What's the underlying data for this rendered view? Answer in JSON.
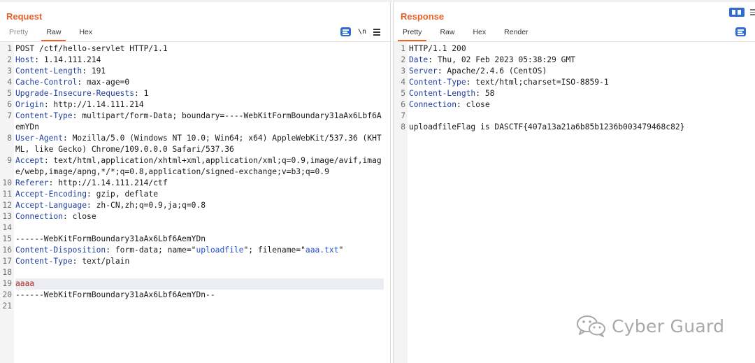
{
  "request": {
    "title": "Request",
    "tabs": [
      {
        "label": "Pretty"
      },
      {
        "label": "Raw"
      },
      {
        "label": "Hex"
      }
    ],
    "newline_toggle": "\\n",
    "lines": [
      {
        "n": "1",
        "segments": [
          {
            "t": "POST /ctf/hello-servlet HTTP/1.1"
          }
        ]
      },
      {
        "n": "2",
        "segments": [
          {
            "t": "Host",
            "c": "k"
          },
          {
            "t": ": 1.14.111.214"
          }
        ]
      },
      {
        "n": "3",
        "segments": [
          {
            "t": "Content-Length",
            "c": "k"
          },
          {
            "t": ": 191"
          }
        ]
      },
      {
        "n": "4",
        "segments": [
          {
            "t": "Cache-Control",
            "c": "k"
          },
          {
            "t": ": max-age=0"
          }
        ]
      },
      {
        "n": "5",
        "segments": [
          {
            "t": "Upgrade-Insecure-Requests",
            "c": "k"
          },
          {
            "t": ": 1"
          }
        ]
      },
      {
        "n": "6",
        "segments": [
          {
            "t": "Origin",
            "c": "k"
          },
          {
            "t": ": http://1.14.111.214"
          }
        ]
      },
      {
        "n": "7",
        "segments": [
          {
            "t": "Content-Type",
            "c": "k"
          },
          {
            "t": ": multipart/form-Data; boundary=----WebKitFormBoundary31aAx6Lbf6AemYDn"
          }
        ]
      },
      {
        "n": "8",
        "segments": [
          {
            "t": "User-Agent",
            "c": "k"
          },
          {
            "t": ": Mozilla/5.0 (Windows NT 10.0; Win64; x64) AppleWebKit/537.36 (KHTML, like Gecko) Chrome/109.0.0.0 Safari/537.36"
          }
        ]
      },
      {
        "n": "9",
        "segments": [
          {
            "t": "Accept",
            "c": "k"
          },
          {
            "t": ": text/html,application/xhtml+xml,application/xml;q=0.9,image/avif,image/webp,image/apng,*/*;q=0.8,application/signed-exchange;v=b3;q=0.9"
          }
        ]
      },
      {
        "n": "10",
        "segments": [
          {
            "t": "Referer",
            "c": "k"
          },
          {
            "t": ": http://1.14.111.214/ctf"
          }
        ]
      },
      {
        "n": "11",
        "segments": [
          {
            "t": "Accept-Encoding",
            "c": "k"
          },
          {
            "t": ": gzip, deflate"
          }
        ]
      },
      {
        "n": "12",
        "segments": [
          {
            "t": "Accept-Language",
            "c": "k"
          },
          {
            "t": ": zh-CN,zh;q=0.9,ja;q=0.8"
          }
        ]
      },
      {
        "n": "13",
        "segments": [
          {
            "t": "Connection",
            "c": "k"
          },
          {
            "t": ": close"
          }
        ]
      },
      {
        "n": "14",
        "segments": []
      },
      {
        "n": "15",
        "segments": [
          {
            "t": "------WebKitFormBoundary31aAx6Lbf6AemYDn"
          }
        ]
      },
      {
        "n": "16",
        "segments": [
          {
            "t": "Content-Disposition",
            "c": "k"
          },
          {
            "t": ": form-data; name=\""
          },
          {
            "t": "uploadfile",
            "c": "s"
          },
          {
            "t": "\"; filename=\""
          },
          {
            "t": "aaa.txt",
            "c": "s"
          },
          {
            "t": "\""
          }
        ]
      },
      {
        "n": "17",
        "segments": [
          {
            "t": "Content-Type",
            "c": "k"
          },
          {
            "t": ": text/plain"
          }
        ]
      },
      {
        "n": "18",
        "segments": []
      },
      {
        "n": "19",
        "highlight": true,
        "segments": [
          {
            "t": "aaaa"
          }
        ]
      },
      {
        "n": "20",
        "segments": [
          {
            "t": "------WebKitFormBoundary31aAx6Lbf6AemYDn--"
          }
        ]
      },
      {
        "n": "21",
        "segments": []
      }
    ]
  },
  "response": {
    "title": "Response",
    "tabs": [
      {
        "label": "Pretty"
      },
      {
        "label": "Raw"
      },
      {
        "label": "Hex"
      },
      {
        "label": "Render"
      }
    ],
    "lines": [
      {
        "n": "1",
        "segments": [
          {
            "t": "HTTP/1.1 200"
          }
        ]
      },
      {
        "n": "2",
        "segments": [
          {
            "t": "Date",
            "c": "k"
          },
          {
            "t": ": Thu, 02 Feb 2023 05:38:29 GMT"
          }
        ]
      },
      {
        "n": "3",
        "segments": [
          {
            "t": "Server",
            "c": "k"
          },
          {
            "t": ": Apache/2.4.6 (CentOS)"
          }
        ]
      },
      {
        "n": "4",
        "segments": [
          {
            "t": "Content-Type",
            "c": "k"
          },
          {
            "t": ": text/html;charset=ISO-8859-1"
          }
        ]
      },
      {
        "n": "5",
        "segments": [
          {
            "t": "Content-Length",
            "c": "k"
          },
          {
            "t": ": 58"
          }
        ]
      },
      {
        "n": "6",
        "segments": [
          {
            "t": "Connection",
            "c": "k"
          },
          {
            "t": ": close"
          }
        ]
      },
      {
        "n": "7",
        "segments": []
      },
      {
        "n": "8",
        "segments": [
          {
            "t": "uploadfileFlag is DASCTF{407a13a21a6b85b1236b003479468c82}"
          }
        ]
      }
    ]
  },
  "watermark": {
    "text": "Cyber Guard",
    "icon": "wechat-icon"
  },
  "colors": {
    "accent": "#e8622a",
    "header_key": "#1e3ea0",
    "string": "#1e4fd6",
    "highlight_text": "#b3261e",
    "button_blue": "#2f6bd6"
  }
}
